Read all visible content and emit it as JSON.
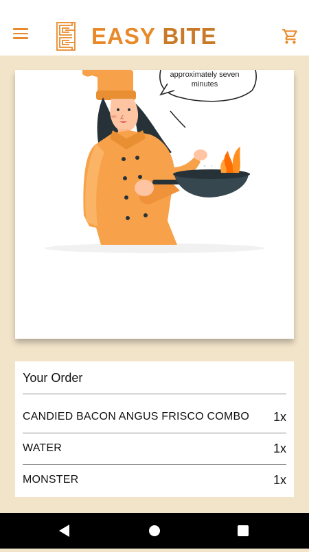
{
  "header": {
    "brand_word1": "EASY",
    "brand_word2": "BITE",
    "menu_icon": "hamburger-menu-icon",
    "cart_icon": "shopping-cart-icon"
  },
  "hero": {
    "speech_text": "approximately seven minutes",
    "illustration": "chef-cooking-illustration"
  },
  "order": {
    "title": "Your Order",
    "items": [
      {
        "name": "CANDIED BACON ANGUS FRISCO COMBO",
        "qty": "1x"
      },
      {
        "name": "WATER",
        "qty": "1x"
      },
      {
        "name": "MONSTER",
        "qty": "1x"
      }
    ]
  },
  "navbar": {
    "back_icon": "back-triangle-icon",
    "home_icon": "home-circle-icon",
    "recents_icon": "recents-square-icon"
  },
  "colors": {
    "accent": "#e98a2a",
    "background": "#f2e4c9",
    "card": "#ffffff"
  }
}
